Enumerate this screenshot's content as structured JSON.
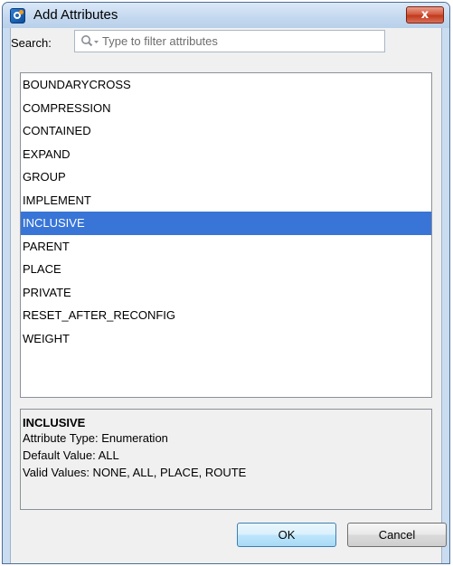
{
  "window": {
    "title": "Add Attributes",
    "close_label": "x"
  },
  "search": {
    "label": "Search:",
    "placeholder": "Type to filter attributes",
    "value": ""
  },
  "attributes": {
    "items": [
      {
        "label": "BOUNDARYCROSS"
      },
      {
        "label": "COMPRESSION"
      },
      {
        "label": "CONTAINED"
      },
      {
        "label": "EXPAND"
      },
      {
        "label": "GROUP"
      },
      {
        "label": "IMPLEMENT"
      },
      {
        "label": "INCLUSIVE"
      },
      {
        "label": "PARENT"
      },
      {
        "label": "PLACE"
      },
      {
        "label": "PRIVATE"
      },
      {
        "label": "RESET_AFTER_RECONFIG"
      },
      {
        "label": "WEIGHT"
      }
    ],
    "selected": "INCLUSIVE"
  },
  "info": {
    "name": "INCLUSIVE",
    "type_line": "Attribute Type: Enumeration",
    "default_line": "Default Value: ALL",
    "valid_line": "Valid Values: NONE, ALL, PLACE, ROUTE"
  },
  "buttons": {
    "ok": "OK",
    "cancel": "Cancel"
  },
  "icons": {
    "app": "app-icon",
    "search": "search-icon",
    "close": "close-icon"
  },
  "colors": {
    "selection": "#3875d7",
    "close": "#c23a1c"
  }
}
